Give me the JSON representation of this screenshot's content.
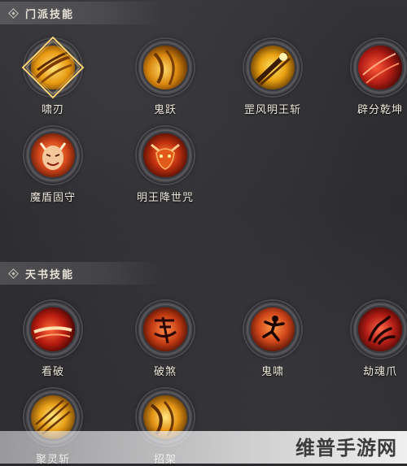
{
  "sections": [
    {
      "title": "门派技能",
      "skills": [
        {
          "name": "啸刃",
          "icon": "golden-slash-icon",
          "selected": true
        },
        {
          "name": "鬼跃",
          "icon": "golden-swirl-icon",
          "selected": false
        },
        {
          "name": "罡风明王斩",
          "icon": "golden-blade-icon",
          "selected": false
        },
        {
          "name": "辟分乾坤",
          "icon": "crimson-strike-icon",
          "selected": false
        },
        {
          "name": "魔盾固守",
          "icon": "demon-mask-icon",
          "selected": false
        },
        {
          "name": "明王降世咒",
          "icon": "fire-demon-icon",
          "selected": false
        }
      ]
    },
    {
      "title": "天书技能",
      "skills": [
        {
          "name": "看破",
          "icon": "red-slash-icon",
          "selected": false
        },
        {
          "name": "破煞",
          "icon": "red-rune-icon",
          "selected": false
        },
        {
          "name": "鬼啸",
          "icon": "running-figure-icon",
          "selected": false
        },
        {
          "name": "劫魂爪",
          "icon": "claw-icon",
          "selected": false
        },
        {
          "name": "聚灵斩",
          "icon": "golden-burst-icon",
          "selected": false
        },
        {
          "name": "招架",
          "icon": "golden-parry-icon",
          "selected": false
        }
      ]
    }
  ],
  "watermark": "维普手游网",
  "colors": {
    "background": "#2b2b2e",
    "gold": "#f0b62a",
    "crimson": "#c8281e"
  }
}
